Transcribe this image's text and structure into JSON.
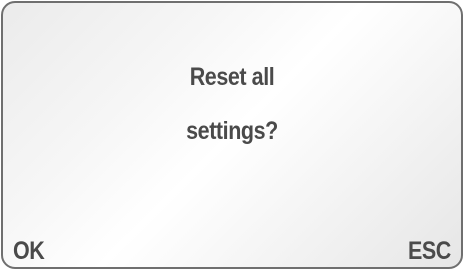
{
  "dialog": {
    "message_line_1": "Reset all",
    "message_line_2": "settings?"
  },
  "softkeys": {
    "left_label": "OK",
    "right_label": "ESC"
  },
  "colors": {
    "text": "#4a4a4a",
    "border": "#6f6f6f",
    "background": "#f4f4f4"
  }
}
